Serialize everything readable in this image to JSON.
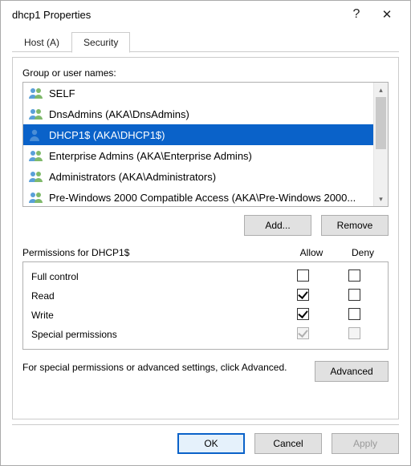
{
  "window": {
    "title": "dhcp1 Properties",
    "help_glyph": "?",
    "close_glyph": "✕"
  },
  "tabs": [
    {
      "label": "Host (A)",
      "active": false
    },
    {
      "label": "Security",
      "active": true
    }
  ],
  "group_label": "Group or user names:",
  "principals": [
    {
      "name": "SELF",
      "icon": "group",
      "selected": false
    },
    {
      "name": "DnsAdmins (AKA\\DnsAdmins)",
      "icon": "group",
      "selected": false
    },
    {
      "name": "DHCP1$ (AKA\\DHCP1$)",
      "icon": "user",
      "selected": true
    },
    {
      "name": "Enterprise Admins (AKA\\Enterprise Admins)",
      "icon": "group",
      "selected": false
    },
    {
      "name": "Administrators (AKA\\Administrators)",
      "icon": "group",
      "selected": false
    },
    {
      "name": "Pre-Windows 2000 Compatible Access (AKA\\Pre-Windows 2000...",
      "icon": "group",
      "selected": false
    }
  ],
  "buttons": {
    "add": "Add...",
    "remove": "Remove",
    "advanced": "Advanced",
    "ok": "OK",
    "cancel": "Cancel",
    "apply": "Apply"
  },
  "permissions_for_label": "Permissions for DHCP1$",
  "perm_columns": {
    "allow": "Allow",
    "deny": "Deny"
  },
  "permissions": [
    {
      "name": "Full control",
      "allow": false,
      "deny": false,
      "disabled": false
    },
    {
      "name": "Read",
      "allow": true,
      "deny": false,
      "disabled": false
    },
    {
      "name": "Write",
      "allow": true,
      "deny": false,
      "disabled": false
    },
    {
      "name": "Special permissions",
      "allow": true,
      "deny": false,
      "disabled": true
    }
  ],
  "advanced_hint": "For special permissions or advanced settings, click Advanced.",
  "colors": {
    "selection": "#0a62c9"
  }
}
